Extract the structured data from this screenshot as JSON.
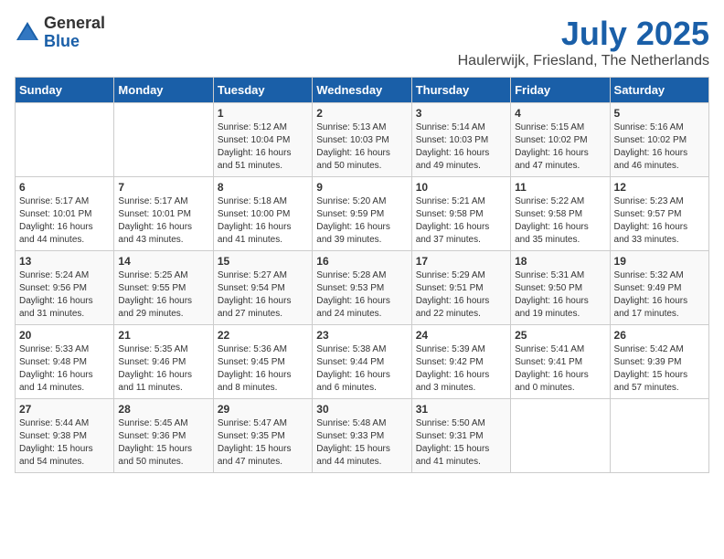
{
  "logo": {
    "general": "General",
    "blue": "Blue"
  },
  "header": {
    "month": "July 2025",
    "location": "Haulerwijk, Friesland, The Netherlands"
  },
  "weekdays": [
    "Sunday",
    "Monday",
    "Tuesday",
    "Wednesday",
    "Thursday",
    "Friday",
    "Saturday"
  ],
  "weeks": [
    [
      {
        "day": "",
        "sunrise": "",
        "sunset": "",
        "daylight": ""
      },
      {
        "day": "",
        "sunrise": "",
        "sunset": "",
        "daylight": ""
      },
      {
        "day": "1",
        "sunrise": "Sunrise: 5:12 AM",
        "sunset": "Sunset: 10:04 PM",
        "daylight": "Daylight: 16 hours and 51 minutes."
      },
      {
        "day": "2",
        "sunrise": "Sunrise: 5:13 AM",
        "sunset": "Sunset: 10:03 PM",
        "daylight": "Daylight: 16 hours and 50 minutes."
      },
      {
        "day": "3",
        "sunrise": "Sunrise: 5:14 AM",
        "sunset": "Sunset: 10:03 PM",
        "daylight": "Daylight: 16 hours and 49 minutes."
      },
      {
        "day": "4",
        "sunrise": "Sunrise: 5:15 AM",
        "sunset": "Sunset: 10:02 PM",
        "daylight": "Daylight: 16 hours and 47 minutes."
      },
      {
        "day": "5",
        "sunrise": "Sunrise: 5:16 AM",
        "sunset": "Sunset: 10:02 PM",
        "daylight": "Daylight: 16 hours and 46 minutes."
      }
    ],
    [
      {
        "day": "6",
        "sunrise": "Sunrise: 5:17 AM",
        "sunset": "Sunset: 10:01 PM",
        "daylight": "Daylight: 16 hours and 44 minutes."
      },
      {
        "day": "7",
        "sunrise": "Sunrise: 5:17 AM",
        "sunset": "Sunset: 10:01 PM",
        "daylight": "Daylight: 16 hours and 43 minutes."
      },
      {
        "day": "8",
        "sunrise": "Sunrise: 5:18 AM",
        "sunset": "Sunset: 10:00 PM",
        "daylight": "Daylight: 16 hours and 41 minutes."
      },
      {
        "day": "9",
        "sunrise": "Sunrise: 5:20 AM",
        "sunset": "Sunset: 9:59 PM",
        "daylight": "Daylight: 16 hours and 39 minutes."
      },
      {
        "day": "10",
        "sunrise": "Sunrise: 5:21 AM",
        "sunset": "Sunset: 9:58 PM",
        "daylight": "Daylight: 16 hours and 37 minutes."
      },
      {
        "day": "11",
        "sunrise": "Sunrise: 5:22 AM",
        "sunset": "Sunset: 9:58 PM",
        "daylight": "Daylight: 16 hours and 35 minutes."
      },
      {
        "day": "12",
        "sunrise": "Sunrise: 5:23 AM",
        "sunset": "Sunset: 9:57 PM",
        "daylight": "Daylight: 16 hours and 33 minutes."
      }
    ],
    [
      {
        "day": "13",
        "sunrise": "Sunrise: 5:24 AM",
        "sunset": "Sunset: 9:56 PM",
        "daylight": "Daylight: 16 hours and 31 minutes."
      },
      {
        "day": "14",
        "sunrise": "Sunrise: 5:25 AM",
        "sunset": "Sunset: 9:55 PM",
        "daylight": "Daylight: 16 hours and 29 minutes."
      },
      {
        "day": "15",
        "sunrise": "Sunrise: 5:27 AM",
        "sunset": "Sunset: 9:54 PM",
        "daylight": "Daylight: 16 hours and 27 minutes."
      },
      {
        "day": "16",
        "sunrise": "Sunrise: 5:28 AM",
        "sunset": "Sunset: 9:53 PM",
        "daylight": "Daylight: 16 hours and 24 minutes."
      },
      {
        "day": "17",
        "sunrise": "Sunrise: 5:29 AM",
        "sunset": "Sunset: 9:51 PM",
        "daylight": "Daylight: 16 hours and 22 minutes."
      },
      {
        "day": "18",
        "sunrise": "Sunrise: 5:31 AM",
        "sunset": "Sunset: 9:50 PM",
        "daylight": "Daylight: 16 hours and 19 minutes."
      },
      {
        "day": "19",
        "sunrise": "Sunrise: 5:32 AM",
        "sunset": "Sunset: 9:49 PM",
        "daylight": "Daylight: 16 hours and 17 minutes."
      }
    ],
    [
      {
        "day": "20",
        "sunrise": "Sunrise: 5:33 AM",
        "sunset": "Sunset: 9:48 PM",
        "daylight": "Daylight: 16 hours and 14 minutes."
      },
      {
        "day": "21",
        "sunrise": "Sunrise: 5:35 AM",
        "sunset": "Sunset: 9:46 PM",
        "daylight": "Daylight: 16 hours and 11 minutes."
      },
      {
        "day": "22",
        "sunrise": "Sunrise: 5:36 AM",
        "sunset": "Sunset: 9:45 PM",
        "daylight": "Daylight: 16 hours and 8 minutes."
      },
      {
        "day": "23",
        "sunrise": "Sunrise: 5:38 AM",
        "sunset": "Sunset: 9:44 PM",
        "daylight": "Daylight: 16 hours and 6 minutes."
      },
      {
        "day": "24",
        "sunrise": "Sunrise: 5:39 AM",
        "sunset": "Sunset: 9:42 PM",
        "daylight": "Daylight: 16 hours and 3 minutes."
      },
      {
        "day": "25",
        "sunrise": "Sunrise: 5:41 AM",
        "sunset": "Sunset: 9:41 PM",
        "daylight": "Daylight: 16 hours and 0 minutes."
      },
      {
        "day": "26",
        "sunrise": "Sunrise: 5:42 AM",
        "sunset": "Sunset: 9:39 PM",
        "daylight": "Daylight: 15 hours and 57 minutes."
      }
    ],
    [
      {
        "day": "27",
        "sunrise": "Sunrise: 5:44 AM",
        "sunset": "Sunset: 9:38 PM",
        "daylight": "Daylight: 15 hours and 54 minutes."
      },
      {
        "day": "28",
        "sunrise": "Sunrise: 5:45 AM",
        "sunset": "Sunset: 9:36 PM",
        "daylight": "Daylight: 15 hours and 50 minutes."
      },
      {
        "day": "29",
        "sunrise": "Sunrise: 5:47 AM",
        "sunset": "Sunset: 9:35 PM",
        "daylight": "Daylight: 15 hours and 47 minutes."
      },
      {
        "day": "30",
        "sunrise": "Sunrise: 5:48 AM",
        "sunset": "Sunset: 9:33 PM",
        "daylight": "Daylight: 15 hours and 44 minutes."
      },
      {
        "day": "31",
        "sunrise": "Sunrise: 5:50 AM",
        "sunset": "Sunset: 9:31 PM",
        "daylight": "Daylight: 15 hours and 41 minutes."
      },
      {
        "day": "",
        "sunrise": "",
        "sunset": "",
        "daylight": ""
      },
      {
        "day": "",
        "sunrise": "",
        "sunset": "",
        "daylight": ""
      }
    ]
  ]
}
